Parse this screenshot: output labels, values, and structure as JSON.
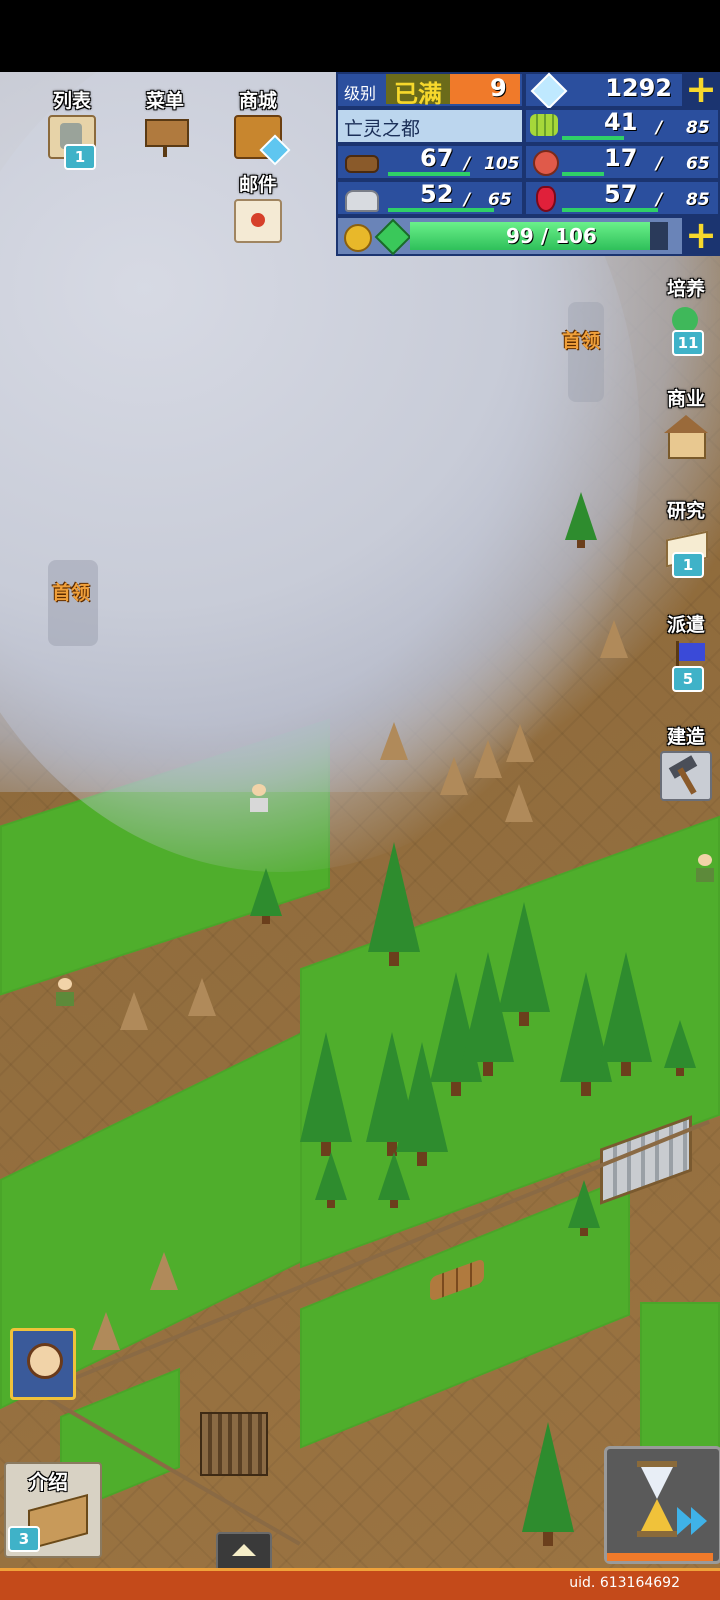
{
  "top_menu": {
    "list_label": "列表",
    "list_badge": "1",
    "menu_label": "菜单",
    "shop_label": "商城",
    "mail_label": "邮件"
  },
  "resources": {
    "level_label": "级别",
    "level_status": "已满",
    "level_value": "9",
    "gems": "1292",
    "town_name": "亡灵之都",
    "food": {
      "value": "41",
      "max": "85"
    },
    "wood": {
      "value": "67",
      "max": "105"
    },
    "meat": {
      "value": "17",
      "max": "65"
    },
    "stone": {
      "value": "52",
      "max": "65"
    },
    "ruby": {
      "value": "57",
      "max": "85"
    },
    "energy": {
      "value": "99",
      "max": "106",
      "fraction": 0.93
    }
  },
  "side_menu": {
    "train_label": "培养",
    "train_badge": "11",
    "commerce_label": "商业",
    "research_label": "研究",
    "research_badge": "1",
    "dispatch_label": "派遣",
    "dispatch_badge": "5",
    "build_label": "建造"
  },
  "map_labels": {
    "chief_right": "首领",
    "chief_left": "首领"
  },
  "intro": {
    "label": "介绍",
    "badge": "3"
  },
  "footer": {
    "uid": "uid. 613164692"
  },
  "colors": {
    "panel_blue": "#2b4f9e",
    "accent_yellow": "#f7d82c",
    "energy_green": "#2fd067",
    "footer_orange": "#c44a1a"
  }
}
